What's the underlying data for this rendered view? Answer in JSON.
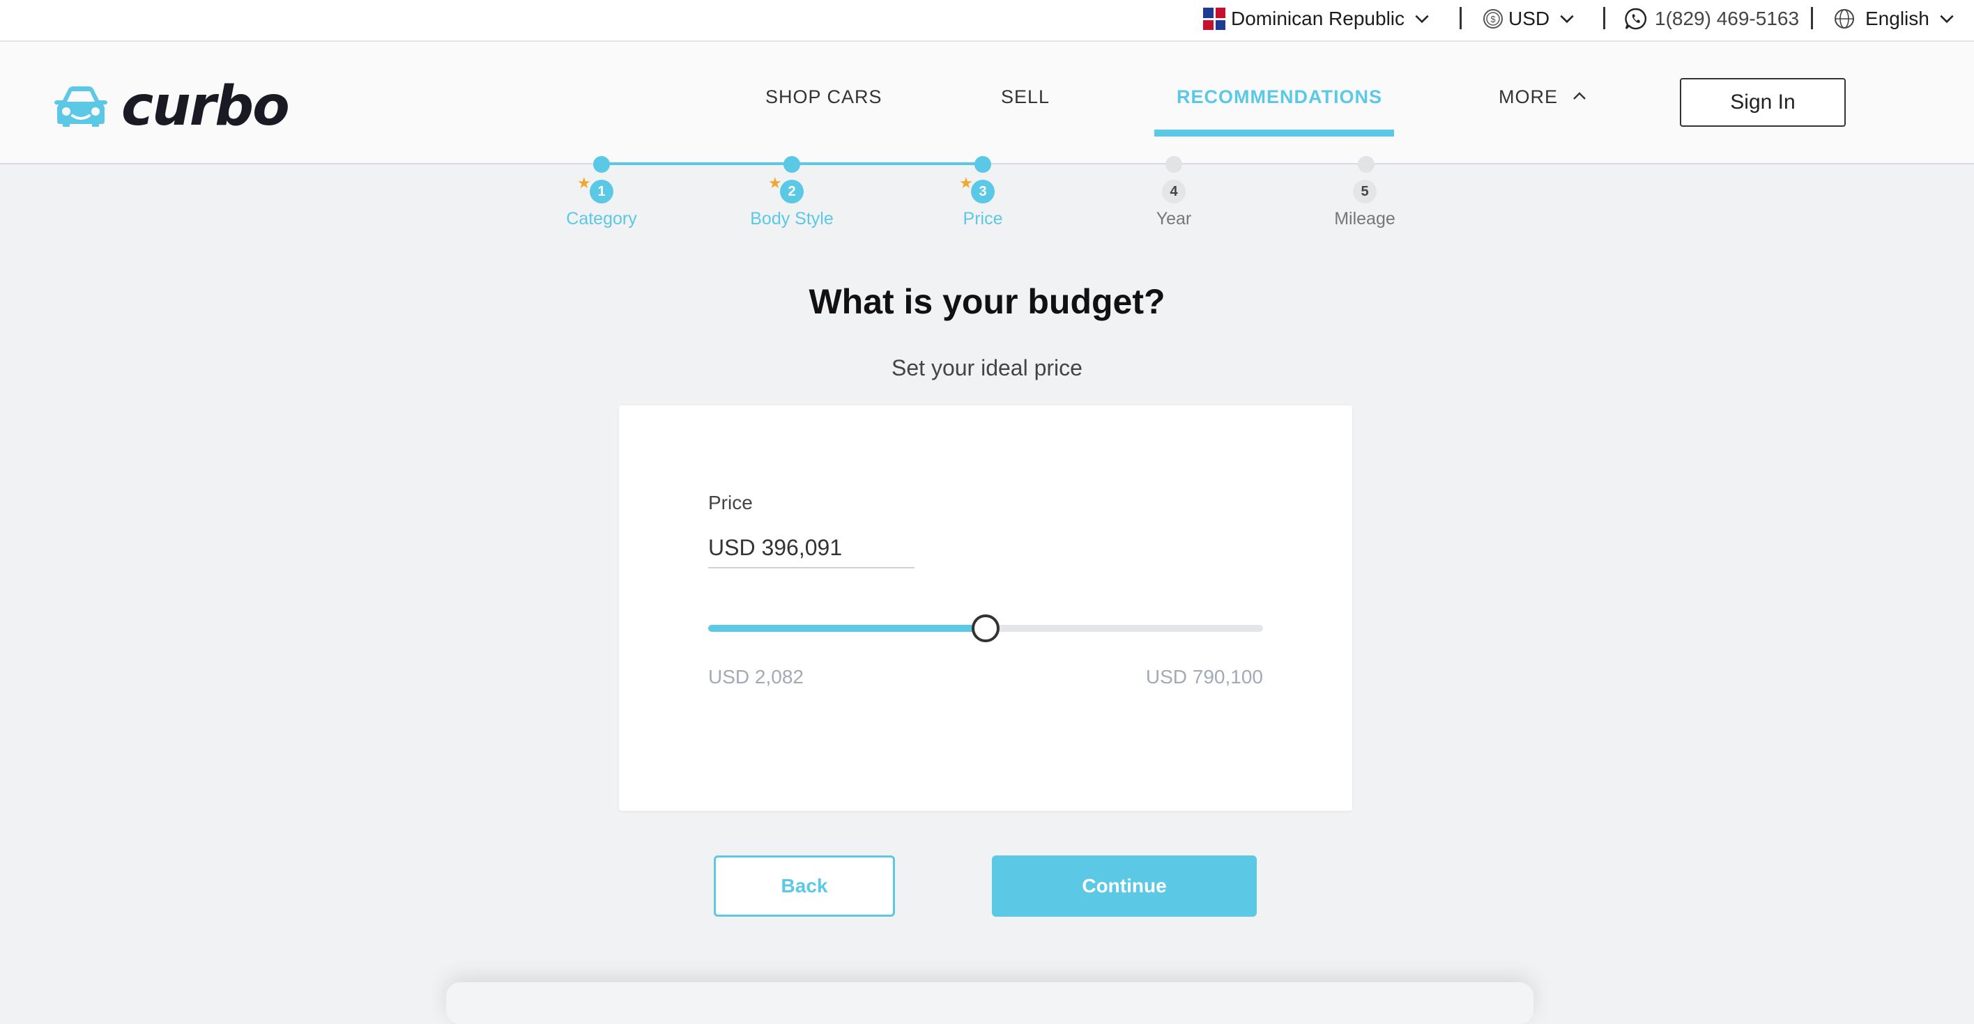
{
  "topbar": {
    "country": "Dominican Republic",
    "currency": "USD",
    "phone": "1(829) 469-5163",
    "language": "English",
    "icons": [
      "dominican-flag-icon",
      "coin-icon",
      "whatsapp-icon",
      "globe-icon",
      "chevron-down-icon"
    ]
  },
  "header": {
    "logo_text": "curbo",
    "nav": [
      {
        "label": "SHOP CARS",
        "active": false
      },
      {
        "label": "SELL",
        "active": false
      },
      {
        "label": "RECOMMENDATIONS",
        "active": true
      },
      {
        "label": "MORE",
        "active": false
      }
    ],
    "sign_in": "Sign In"
  },
  "stepper": {
    "steps": [
      {
        "num": "1",
        "label": "Category",
        "done": true
      },
      {
        "num": "2",
        "label": "Body Style",
        "done": true
      },
      {
        "num": "3",
        "label": "Price",
        "done": true
      },
      {
        "num": "4",
        "label": "Year",
        "done": false
      },
      {
        "num": "5",
        "label": "Mileage",
        "done": false
      }
    ],
    "star": "★"
  },
  "main": {
    "title": "What is your budget?",
    "subtitle": "Set your ideal price",
    "price_label": "Price",
    "price_value": "USD 396,091",
    "slider_fraction": 0.5,
    "range_min": "USD 2,082",
    "range_max": "USD 790,100",
    "back": "Back",
    "continue": "Continue"
  },
  "colors": {
    "accent": "#5bc8e6",
    "star": "#f0a830",
    "background": "#f1f2f4"
  }
}
